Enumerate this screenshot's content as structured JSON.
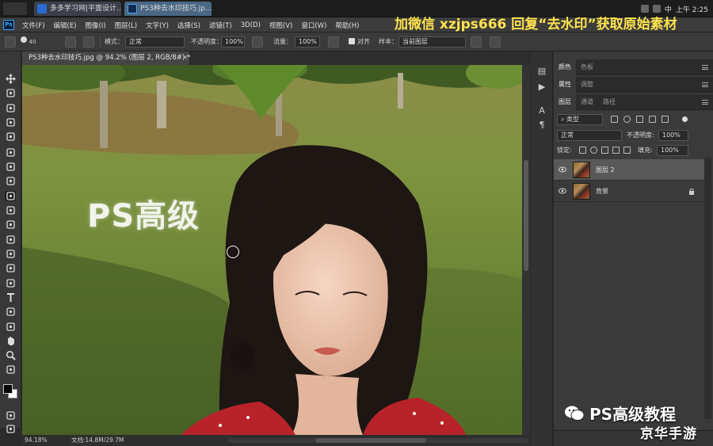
{
  "os": {
    "tabs": [
      {
        "label": "多多学习网|平面设计..."
      },
      {
        "label": "PS3种去水印技巧.jp..."
      }
    ],
    "tray_right": [
      "中",
      "上午 2:25"
    ]
  },
  "menubar": {
    "logo": "Ps",
    "items": [
      "文件(F)",
      "编辑(E)",
      "图像(I)",
      "图层(L)",
      "文字(Y)",
      "选择(S)",
      "滤镜(T)",
      "3D(D)",
      "视图(V)",
      "窗口(W)",
      "帮助(H)"
    ],
    "promo": "加微信 xzjps666 回复“去水印”获取原始素材"
  },
  "options": {
    "brush_size": "40",
    "mode_label": "模式：",
    "mode_value": "正常",
    "opacity_label": "不透明度：",
    "opacity_value": "100%",
    "flow_label": "流量：",
    "flow_value": "100%",
    "align_label": "对齐",
    "sample_label": "样本：",
    "sample_value": "当前图层"
  },
  "document": {
    "tab_title": "PS3种去水印技巧.jpg @ 94.2% (图层 2, RGB/8#) *",
    "close": "×",
    "watermark_text": "PS高级",
    "zoom": "94.18%",
    "doc_size": "文档:14.8M/29.7M"
  },
  "panels": {
    "group1_tabs": [
      "颜色",
      "色板"
    ],
    "group2_tabs": [
      "属性",
      "调整"
    ],
    "layers_tabs": [
      "图层",
      "通道",
      "路径"
    ],
    "filter_kind": "类型",
    "blend_mode": "正常",
    "opacity_label": "不透明度:",
    "opacity_value": "100%",
    "lock_label": "锁定:",
    "fill_label": "填充:",
    "fill_value": "100%",
    "layers": [
      {
        "name": "图层 2",
        "selected": true,
        "locked": false
      },
      {
        "name": "背景",
        "selected": false,
        "locked": true
      }
    ]
  },
  "overlay": {
    "wechat_text": "PS高级教程",
    "site_logo": "京华手游"
  },
  "colors": {
    "accent": "#31a8ff",
    "promo_yellow": "#ffe34d"
  }
}
